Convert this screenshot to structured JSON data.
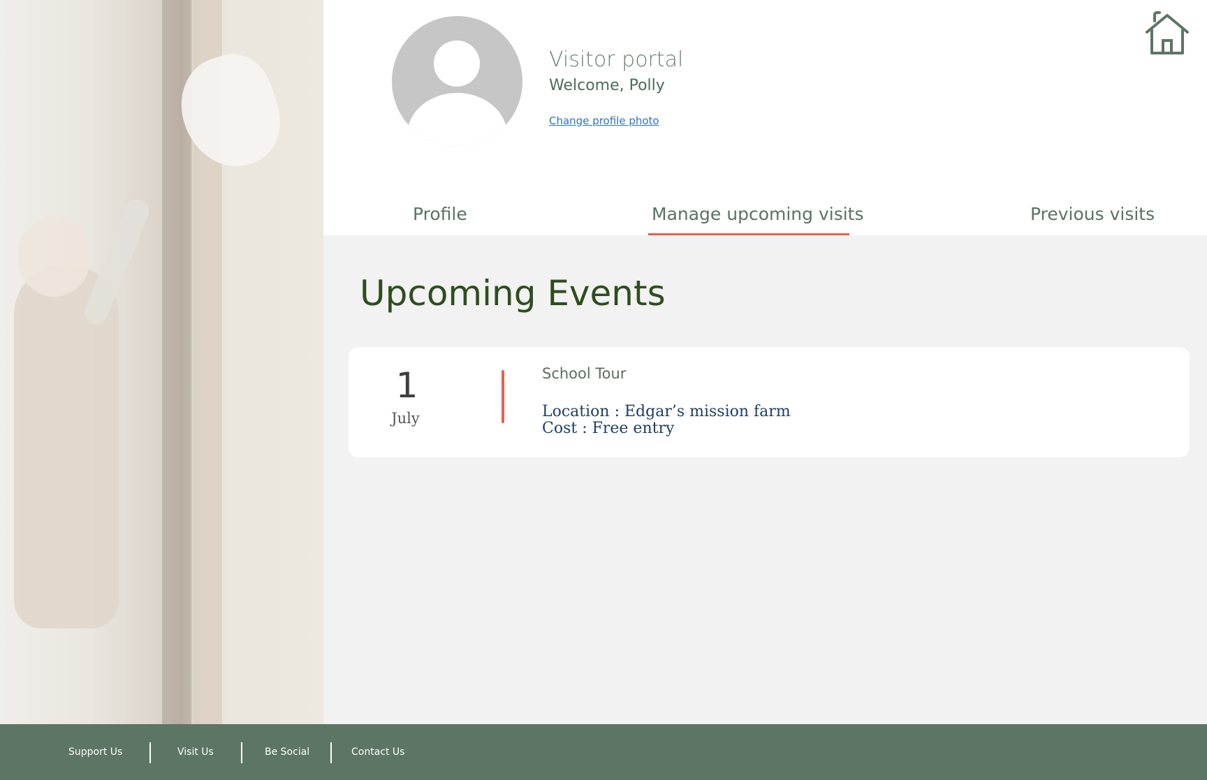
{
  "header": {
    "portal_title": "Visitor portal",
    "welcome": "Welcome, Polly",
    "change_photo": "Change profile photo",
    "home_icon": "home-icon",
    "avatar_icon": "user-avatar-icon"
  },
  "tabs": [
    {
      "label": "Profile",
      "active": false
    },
    {
      "label": "Manage upcoming visits",
      "active": true
    },
    {
      "label": "Previous visits",
      "active": false
    }
  ],
  "main": {
    "section_title": "Upcoming Events",
    "events": [
      {
        "day": "1",
        "month": "July",
        "name": "School Tour",
        "location": "Location : Edgar’s mission farm",
        "cost": "Cost : Free entry"
      }
    ]
  },
  "footer": {
    "links": [
      "Support Us",
      "Visit Us",
      "Be Social",
      "Contact Us"
    ]
  },
  "colors": {
    "accent": "#e8604c",
    "footer_bg": "#5d7565",
    "heading_green": "#2e4d1e",
    "link_blue": "#2d72c4"
  }
}
